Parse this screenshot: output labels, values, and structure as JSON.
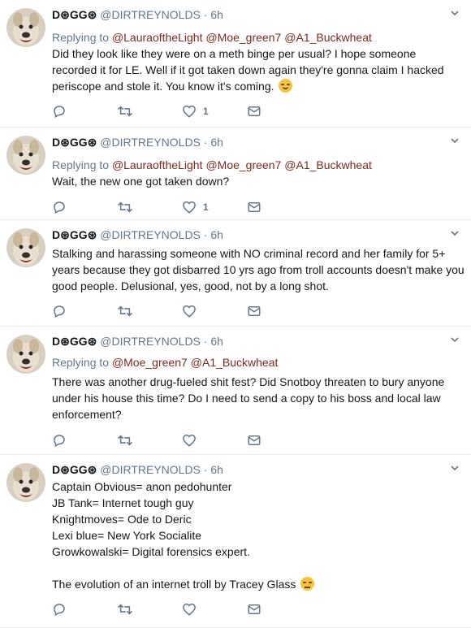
{
  "colors": {
    "text": "#14171a",
    "secondary": "#657786",
    "mention": "#7b2a1f",
    "divider": "#e6ecf0",
    "emoji": "#f7c33e"
  },
  "icons": [
    "avatar-dog",
    "chevron-down-icon",
    "reply-icon",
    "retweet-icon",
    "like-icon",
    "message-icon",
    "smirk-emoji-icon",
    "eye-roll-emoji-icon"
  ],
  "tweets": [
    {
      "display_name": "D⊛GG⊛",
      "handle": "@DIRTREYNOLDS",
      "separator": "·",
      "time": "6h",
      "replying_to_label": "Replying to",
      "mentions": [
        "@LauraoftheLight",
        "@Moe_green7",
        "@A1_Buckwheat"
      ],
      "lines": [
        "Did they look like they were on a meth binge per usual? I hope someone",
        "recorded it for LE. Well if it got taken down again they're gonna claim I hacked",
        "periscope and stole it. You know it's coming."
      ],
      "emoji": "smirk",
      "like_count": "1"
    },
    {
      "display_name": "D⊛GG⊛",
      "handle": "@DIRTREYNOLDS",
      "separator": "·",
      "time": "6h",
      "replying_to_label": "Replying to",
      "mentions": [
        "@LauraoftheLight",
        "@Moe_green7",
        "@A1_Buckwheat"
      ],
      "lines": [
        "Wait, the new one got taken down?"
      ],
      "like_count": "1"
    },
    {
      "display_name": "D⊛GG⊛",
      "handle": "@DIRTREYNOLDS",
      "separator": "·",
      "time": "6h",
      "lines": [
        "Stalking and harassing someone with NO criminal record and her family for 5+",
        "years because they got disbarred 10 yrs ago from troll accounts doesn't make you",
        "good people. Delusional, yes, good, not by a long shot."
      ]
    },
    {
      "display_name": "D⊛GG⊛",
      "handle": "@DIRTREYNOLDS",
      "separator": "·",
      "time": "6h",
      "replying_to_label": "Replying to",
      "mentions": [
        "@Moe_green7",
        "@A1_Buckwheat"
      ],
      "lines": [
        "There was another drug-fueled shit fest? Did Snotboy threaten to bury anyone",
        "under his house this time? Do I need to send a copy to his boss and local law",
        "enforcement?"
      ]
    },
    {
      "display_name": "D⊛GG⊛",
      "handle": "@DIRTREYNOLDS",
      "separator": "·",
      "time": "6h",
      "lines": [
        "Captain Obvious= anon pedohunter",
        "JB Tank= Internet tough guy",
        "Knightmoves= Ode to Deric",
        "Lexi blue= New York Socialite",
        "Growkowalski= Digital forensics expert.",
        "",
        "The evolution of an internet troll by Tracey Glass"
      ],
      "emoji": "roll"
    }
  ]
}
